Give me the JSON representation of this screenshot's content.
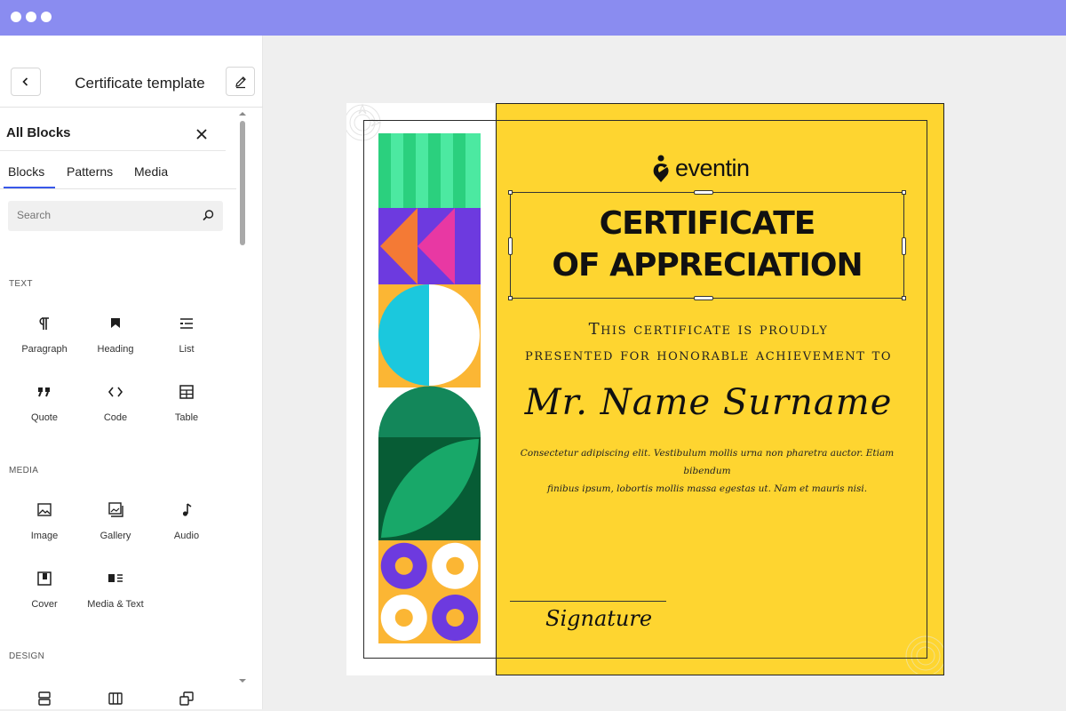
{
  "window": {
    "dots": 3
  },
  "sidebar": {
    "title": "Certificate template",
    "back_icon": "chevron-left-icon",
    "edit_icon": "pencil-icon"
  },
  "inserter": {
    "title": "All Blocks",
    "tabs": [
      {
        "label": "Blocks",
        "active": true
      },
      {
        "label": "Patterns",
        "active": false
      },
      {
        "label": "Media",
        "active": false
      }
    ],
    "search": {
      "placeholder": "Search"
    },
    "categories": [
      {
        "label": "TEXT",
        "blocks": [
          {
            "label": "Paragraph",
            "icon": "paragraph-icon"
          },
          {
            "label": "Heading",
            "icon": "heading-icon"
          },
          {
            "label": "List",
            "icon": "list-icon"
          },
          {
            "label": "Quote",
            "icon": "quote-icon"
          },
          {
            "label": "Code",
            "icon": "code-icon"
          },
          {
            "label": "Table",
            "icon": "table-icon"
          }
        ]
      },
      {
        "label": "MEDIA",
        "blocks": [
          {
            "label": "Image",
            "icon": "image-icon"
          },
          {
            "label": "Gallery",
            "icon": "gallery-icon"
          },
          {
            "label": "Audio",
            "icon": "audio-icon"
          },
          {
            "label": "Cover",
            "icon": "cover-icon"
          },
          {
            "label": "Media & Text",
            "icon": "media-text-icon"
          }
        ]
      },
      {
        "label": "DESIGN",
        "blocks": [
          {
            "label": "",
            "icon": "group-icon"
          },
          {
            "label": "",
            "icon": "columns-icon"
          },
          {
            "label": "",
            "icon": "duplicate-icon"
          }
        ]
      }
    ]
  },
  "certificate": {
    "logo_text": "eventin",
    "title_line1": "CERTIFICATE",
    "title_line2": "OF APPRECIATION",
    "subtitle_line1": "This certificate is proudly",
    "subtitle_line2": "presented for honorable achievement to",
    "recipient": "Mr. Name Surname",
    "body_line1": "Consectetur adipiscing elit. Vestibulum mollis urna non pharetra auctor. Etiam bibendum",
    "body_line2": "finibus ipsum, lobortis mollis massa egestas ut. Nam et mauris nisi.",
    "signature": "Signature",
    "colors": {
      "background": "#fed530",
      "green": "#0f9d58",
      "purple": "#6d3adf",
      "cyan": "#1bc8dd"
    }
  },
  "colors": {
    "browser_bar": "#8a8cf0",
    "accent": "#3858e9"
  }
}
